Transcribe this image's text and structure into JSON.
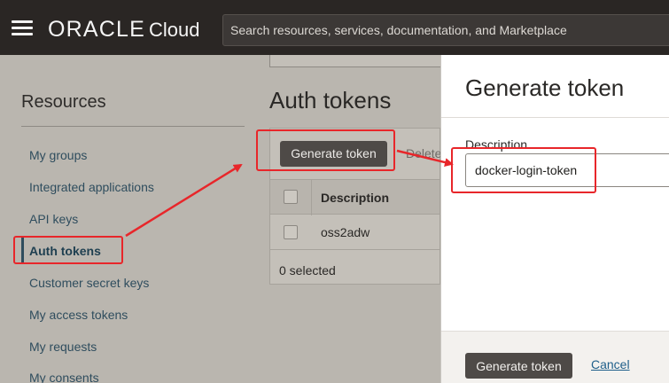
{
  "topbar": {
    "menu_icon": "hamburger-menu-icon",
    "brand_oracle": "ORACLE",
    "brand_cloud": "Cloud",
    "search_placeholder": "Search resources, services, documentation, and Marketplace"
  },
  "sidebar": {
    "title": "Resources",
    "items": [
      {
        "label": "My groups"
      },
      {
        "label": "Integrated applications"
      },
      {
        "label": "API keys"
      },
      {
        "label": "Auth tokens",
        "active": true
      },
      {
        "label": "Customer secret keys"
      },
      {
        "label": "My access tokens"
      },
      {
        "label": "My requests"
      },
      {
        "label": "My consents"
      }
    ]
  },
  "main": {
    "title": "Auth tokens",
    "generate_label": "Generate token",
    "delete_label": "Delete",
    "table": {
      "columns": [
        "Description"
      ],
      "rows": [
        {
          "description": "oss2adw"
        }
      ]
    },
    "selected_text": "0 selected"
  },
  "panel": {
    "title": "Generate token",
    "description_label": "Description",
    "description_value": "docker-login-token",
    "generate_label": "Generate token",
    "cancel_label": "Cancel"
  },
  "colors": {
    "topbar": "#2a2624",
    "annotation": "#e8262a",
    "primary_button": "#4e4a47",
    "link": "#1f5f8a"
  }
}
